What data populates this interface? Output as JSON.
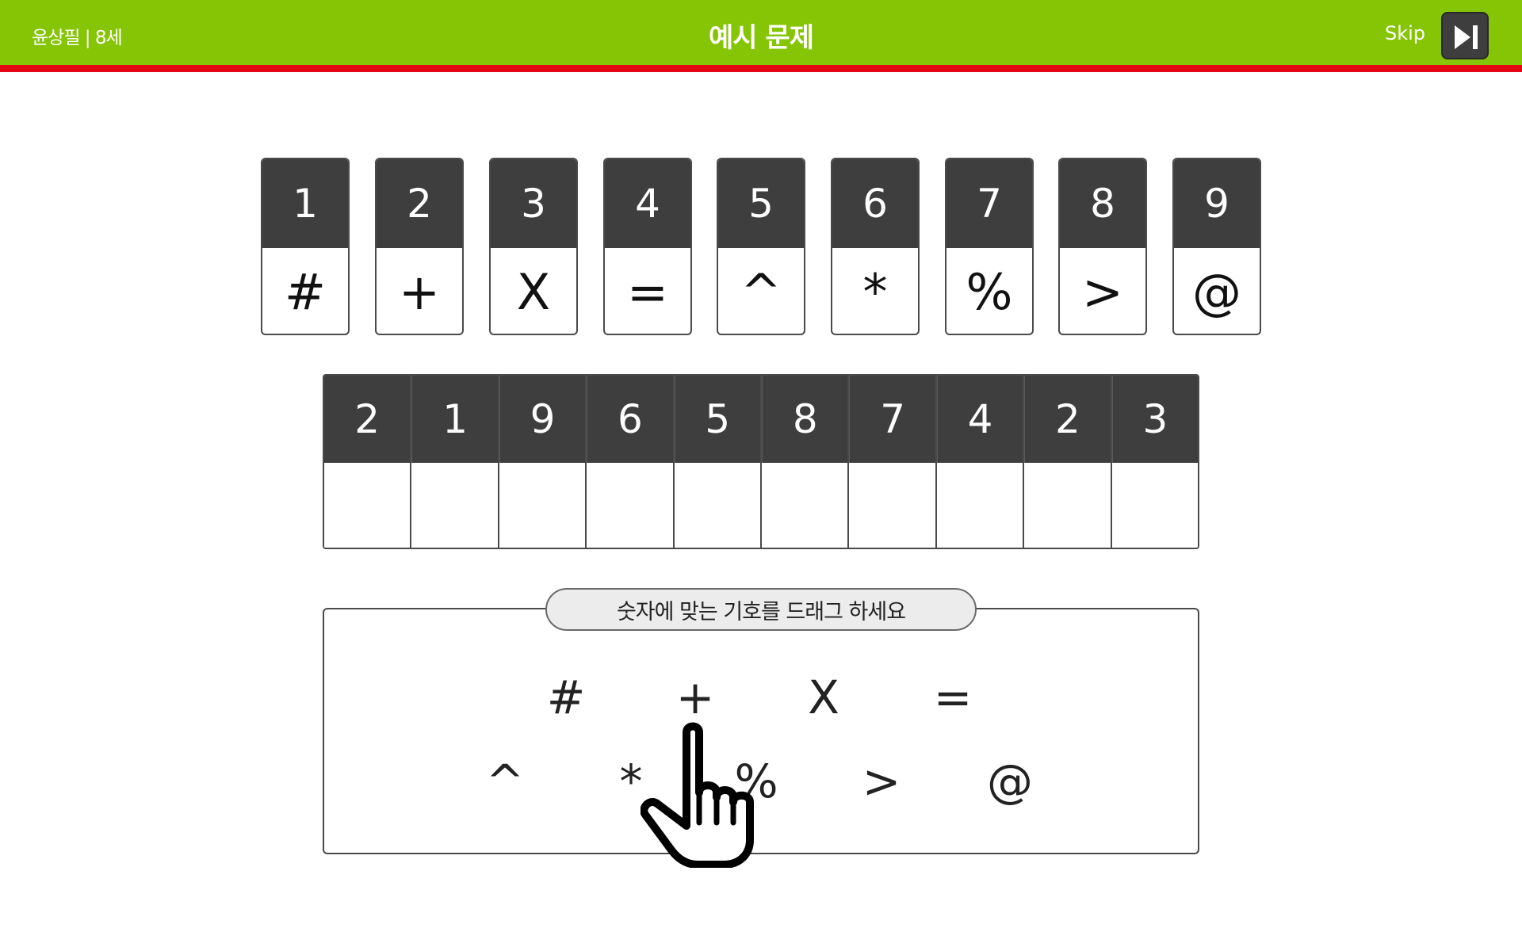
{
  "header": {
    "user_info": "윤상필 | 8세",
    "title": "예시 문제",
    "skip_label": "Skip",
    "skip_icon": "skip-forward-icon",
    "bg_color": "#86c406",
    "accent_color": "#e30613"
  },
  "key": [
    {
      "number": "1",
      "symbol": "#"
    },
    {
      "number": "2",
      "symbol": "+"
    },
    {
      "number": "3",
      "symbol": "X"
    },
    {
      "number": "4",
      "symbol": "="
    },
    {
      "number": "5",
      "symbol": "^"
    },
    {
      "number": "6",
      "symbol": "*"
    },
    {
      "number": "7",
      "symbol": "%"
    },
    {
      "number": "8",
      "symbol": ">"
    },
    {
      "number": "9",
      "symbol": "@"
    }
  ],
  "questions": [
    "2",
    "1",
    "9",
    "6",
    "5",
    "8",
    "7",
    "4",
    "2",
    "3"
  ],
  "instruction": "숫자에 맞는 기호를 드래그 하세요",
  "palette": {
    "row1": [
      "#",
      "+",
      "X",
      "="
    ],
    "row2": [
      "^",
      "*",
      "%",
      ">",
      "@"
    ]
  },
  "cursor_icon": "hand-pointer-icon"
}
